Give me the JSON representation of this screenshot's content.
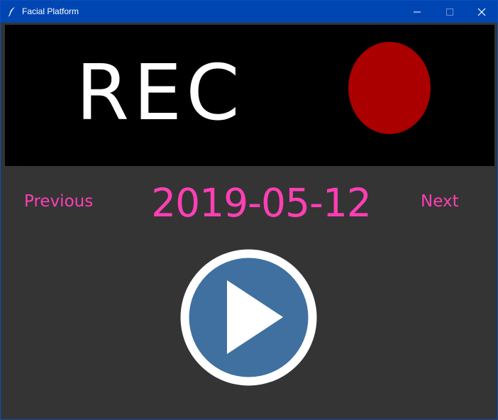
{
  "window": {
    "title": "Facial Platform",
    "icons": {
      "app": "feather-icon",
      "minimize": "minimize-icon",
      "maximize": "maximize-icon",
      "close": "close-icon"
    }
  },
  "banner": {
    "text": "REC",
    "indicator": "record-dot-icon",
    "colors": {
      "background": "#000000",
      "text": "#ffffff",
      "dot": "#aa0000"
    }
  },
  "navigation": {
    "previous_label": "Previous",
    "next_label": "Next",
    "date": "2019-05-12",
    "color": "#ff3fb4"
  },
  "player": {
    "play_icon": "play-icon",
    "colors": {
      "fill": "#4070a0",
      "ring": "#ffffff"
    }
  }
}
